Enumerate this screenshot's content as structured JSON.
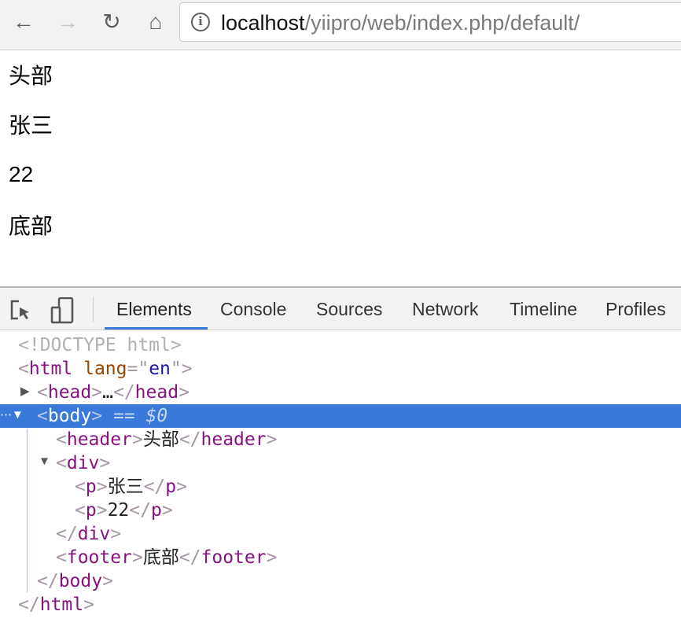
{
  "browser": {
    "url_host": "localhost",
    "url_path": "/yiipro/web/index.php/default/",
    "icons": [
      "back-arrow-icon",
      "forward-arrow-icon",
      "reload-icon",
      "home-icon",
      "info-icon"
    ]
  },
  "page": {
    "lines": [
      "头部",
      "张三",
      "22",
      "底部"
    ]
  },
  "devtools": {
    "tabs": [
      "Elements",
      "Console",
      "Sources",
      "Network",
      "Timeline",
      "Profiles"
    ],
    "active_tab": "Elements",
    "accent": "#3879d9",
    "tree": {
      "doctype": "<!DOCTYPE html>",
      "html_tag": "html",
      "lang_attr": "lang",
      "lang_value": "en",
      "head_tag": "head",
      "ellipsis": "…",
      "body_tag": "body",
      "selected_marker": "== $0",
      "header_tag": "header",
      "header_text": "头部",
      "div_tag": "div",
      "p1_text": "张三",
      "p2_text": "22",
      "p_tag": "p",
      "footer_tag": "footer",
      "footer_text": "底部"
    }
  }
}
